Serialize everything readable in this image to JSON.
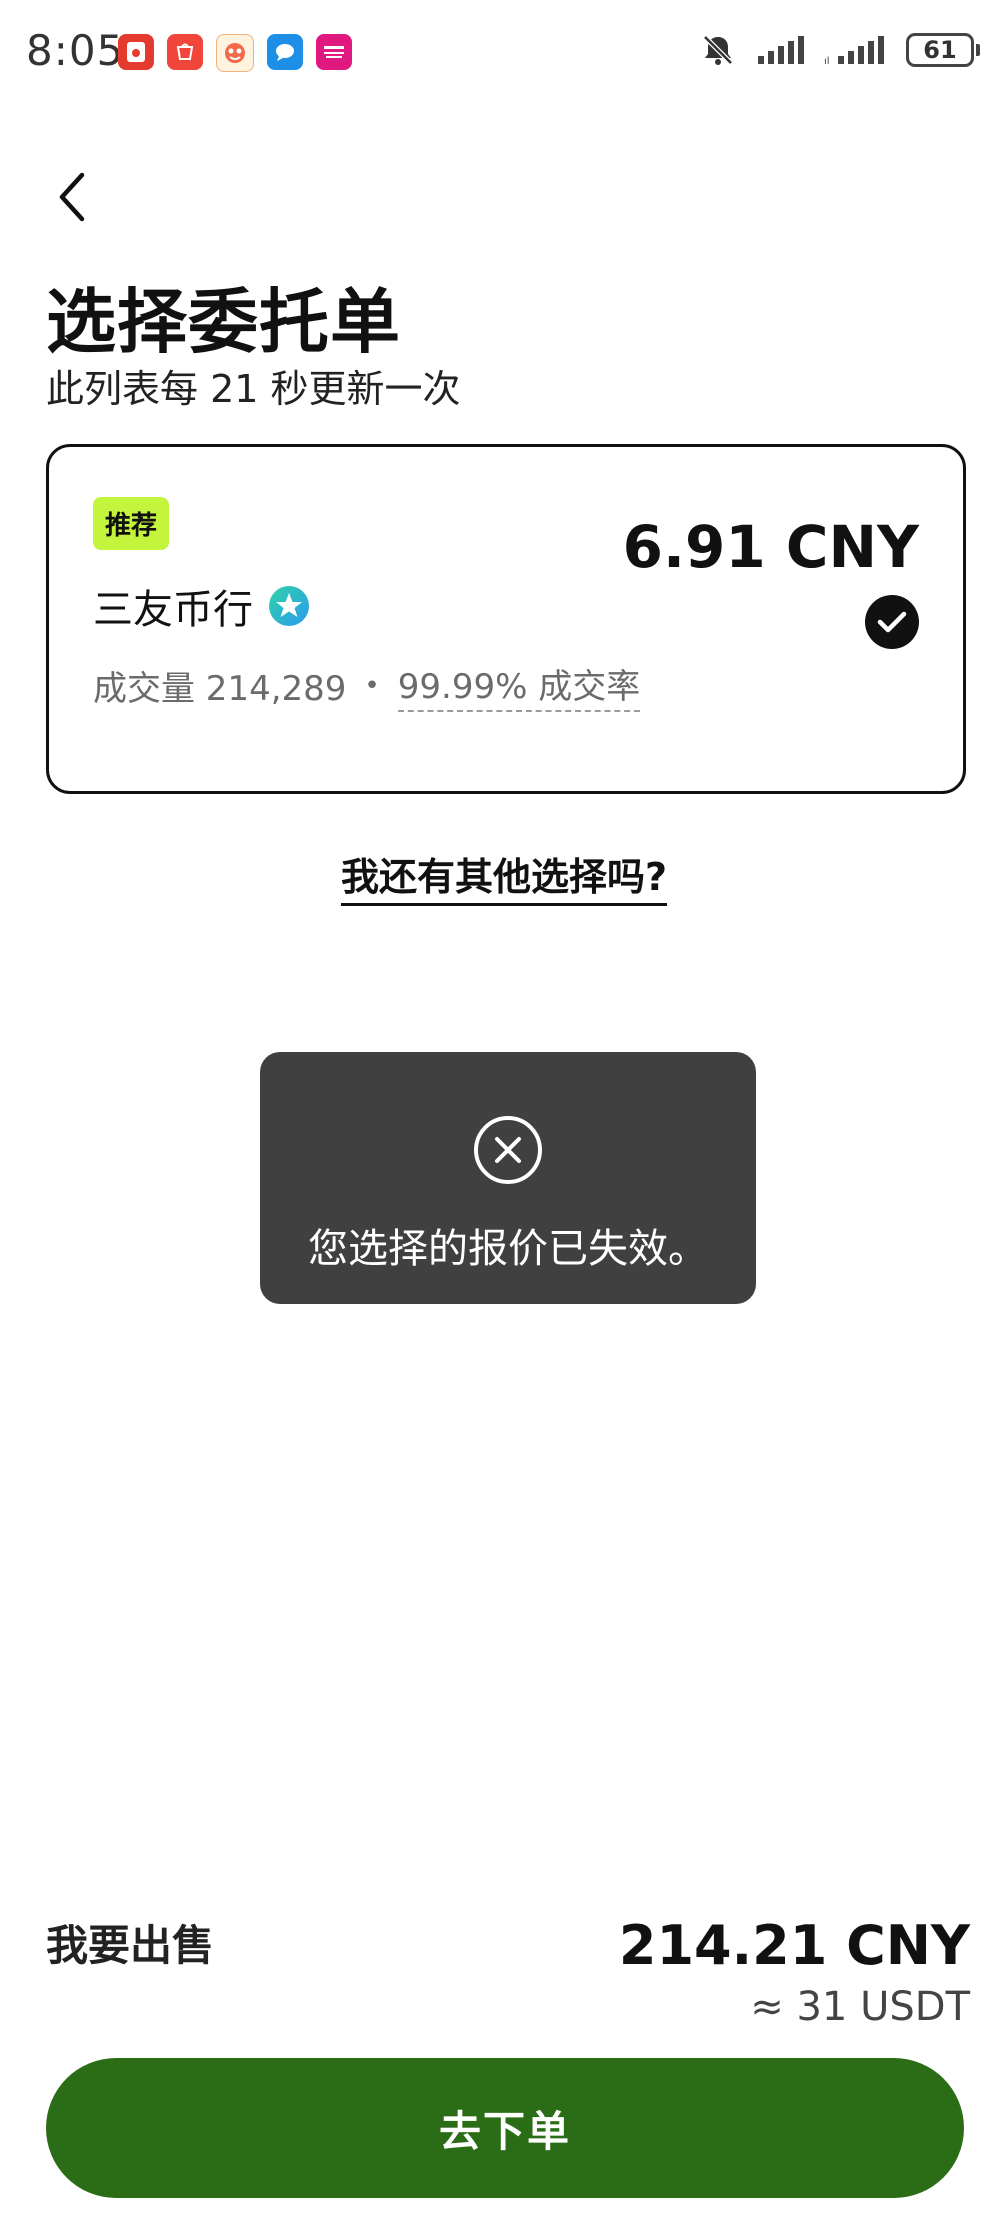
{
  "status_bar": {
    "time": "8:05",
    "battery": "61",
    "notification_icons": [
      {
        "name": "red-envelope-app-icon",
        "color": "#e53a2e"
      },
      {
        "name": "huawei-store-app-icon",
        "color": "#f0463c"
      },
      {
        "name": "cartoon-app-icon",
        "color": "#f26a4a"
      },
      {
        "name": "message-app-icon",
        "color": "#1e8fe6"
      },
      {
        "name": "shopping-app-icon",
        "color": "#e0187f"
      }
    ]
  },
  "header": {
    "title": "选择委托单",
    "subtitle": "此列表每 21 秒更新一次"
  },
  "offer": {
    "badge": "推荐",
    "merchant": "三友币行",
    "volume_label": "成交量 214,289",
    "separator": "•",
    "completion_rate": "99.99% 成交率",
    "price": "6.91 CNY",
    "selected": true
  },
  "other_choice_link": "我还有其他选择吗?",
  "toast": {
    "message": "您选择的报价已失效。",
    "icon": "close-circle-icon"
  },
  "summary": {
    "sell_label": "我要出售",
    "amount": "214.21 CNY",
    "approx": "≈ 31 USDT"
  },
  "action": {
    "place_order_label": "去下单"
  },
  "colors": {
    "accent": "#2b6d17",
    "badge": "#c3f53c",
    "toast_bg": "#404040"
  }
}
